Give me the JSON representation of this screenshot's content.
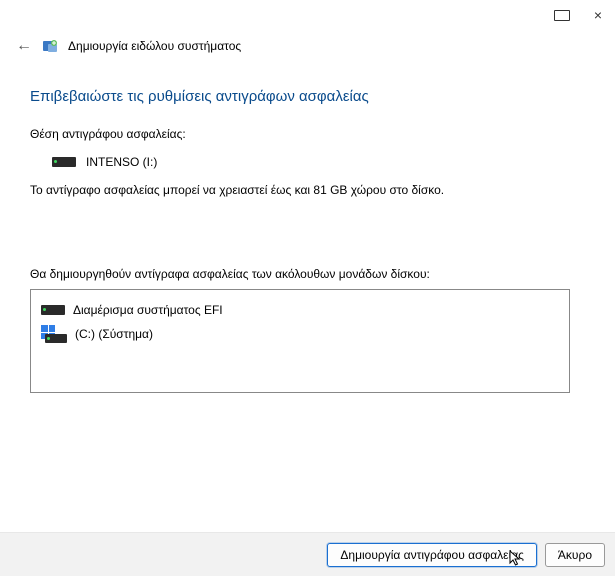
{
  "titlebar": {
    "maximize_restore": "monitors",
    "close": "×"
  },
  "header": {
    "back": "←",
    "title": "Δημιουργία ειδώλου συστήματος"
  },
  "main": {
    "heading": "Επιβεβαιώστε τις ρυθμίσεις αντιγράφων ασφαλείας",
    "location_label": "Θέση αντιγράφου ασφαλείας:",
    "drive_name": "INTENSO (I:)",
    "space_info": "Το αντίγραφο ασφαλείας μπορεί να χρειαστεί έως και 81 GB χώρου στο δίσκο.",
    "drives_label": "Θα δημιουργηθούν αντίγραφα ασφαλείας των ακόλουθων μονάδων δίσκου:",
    "items": [
      {
        "label": "Διαμέρισμα συστήματος EFI"
      },
      {
        "label": "(C:) (Σύστημα)"
      }
    ]
  },
  "footer": {
    "primary": "Δημιουργία αντιγράφου ασφαλείας",
    "cancel": "Άκυρο"
  }
}
